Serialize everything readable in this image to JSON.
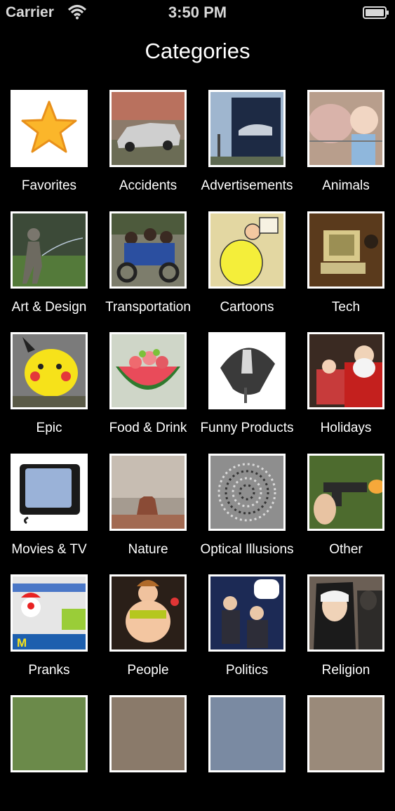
{
  "status": {
    "carrier": "Carrier",
    "time": "3:50 PM"
  },
  "nav": {
    "title": "Categories"
  },
  "categories": [
    {
      "label": "Favorites",
      "icon": "star-icon"
    },
    {
      "label": "Accidents",
      "icon": "car-crash-photo"
    },
    {
      "label": "Advertisements",
      "icon": "billboard-photo"
    },
    {
      "label": "Animals",
      "icon": "pig-baby-photo"
    },
    {
      "label": "Art & Design",
      "icon": "statue-photo"
    },
    {
      "label": "Transportation",
      "icon": "scooter-photo"
    },
    {
      "label": "Cartoons",
      "icon": "cartoon-photo"
    },
    {
      "label": "Tech",
      "icon": "old-computer-photo"
    },
    {
      "label": "Epic",
      "icon": "pikachu-balloon-photo"
    },
    {
      "label": "Food & Drink",
      "icon": "watermelon-bowl-photo"
    },
    {
      "label": "Funny Products",
      "icon": "umbrella-photo"
    },
    {
      "label": "Holidays",
      "icon": "santa-photo"
    },
    {
      "label": "Movies & TV",
      "icon": "old-tv-photo"
    },
    {
      "label": "Nature",
      "icon": "desert-mesa-photo"
    },
    {
      "label": "Optical Illusions",
      "icon": "spiral-illusion-photo"
    },
    {
      "label": "Other",
      "icon": "gun-photo"
    },
    {
      "label": "Pranks",
      "icon": "clown-car-photo"
    },
    {
      "label": "People",
      "icon": "dancer-photo"
    },
    {
      "label": "Politics",
      "icon": "politicians-photo"
    },
    {
      "label": "Religion",
      "icon": "nuns-photo"
    }
  ]
}
